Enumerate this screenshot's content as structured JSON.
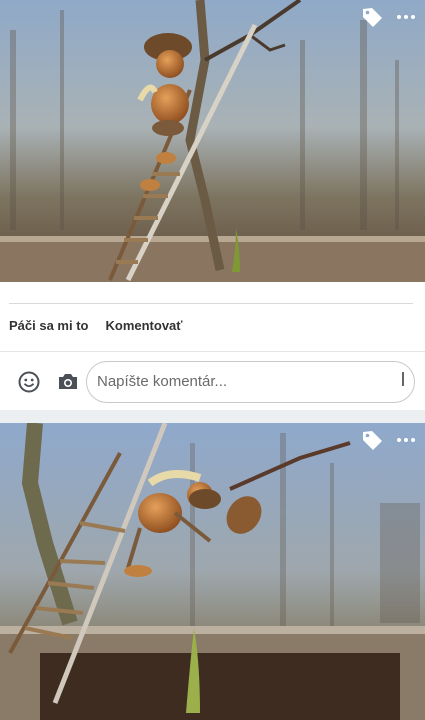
{
  "posts": [
    {
      "icons": {
        "tag": "tag-icon",
        "more": "more-horizontal-icon"
      }
    },
    {
      "icons": {
        "tag": "tag-icon",
        "more": "more-horizontal-icon"
      }
    }
  ],
  "actions": {
    "like_label": "Páči sa mi to",
    "comment_label": "Komentovať"
  },
  "comment": {
    "placeholder": "Napíšte komentár...",
    "emoji_icon": "smile-icon",
    "camera_icon": "camera-icon"
  },
  "colors": {
    "icon_color": "#4b4f56",
    "sky_top": "#9db4cf",
    "ground": "#6e5b4a"
  }
}
